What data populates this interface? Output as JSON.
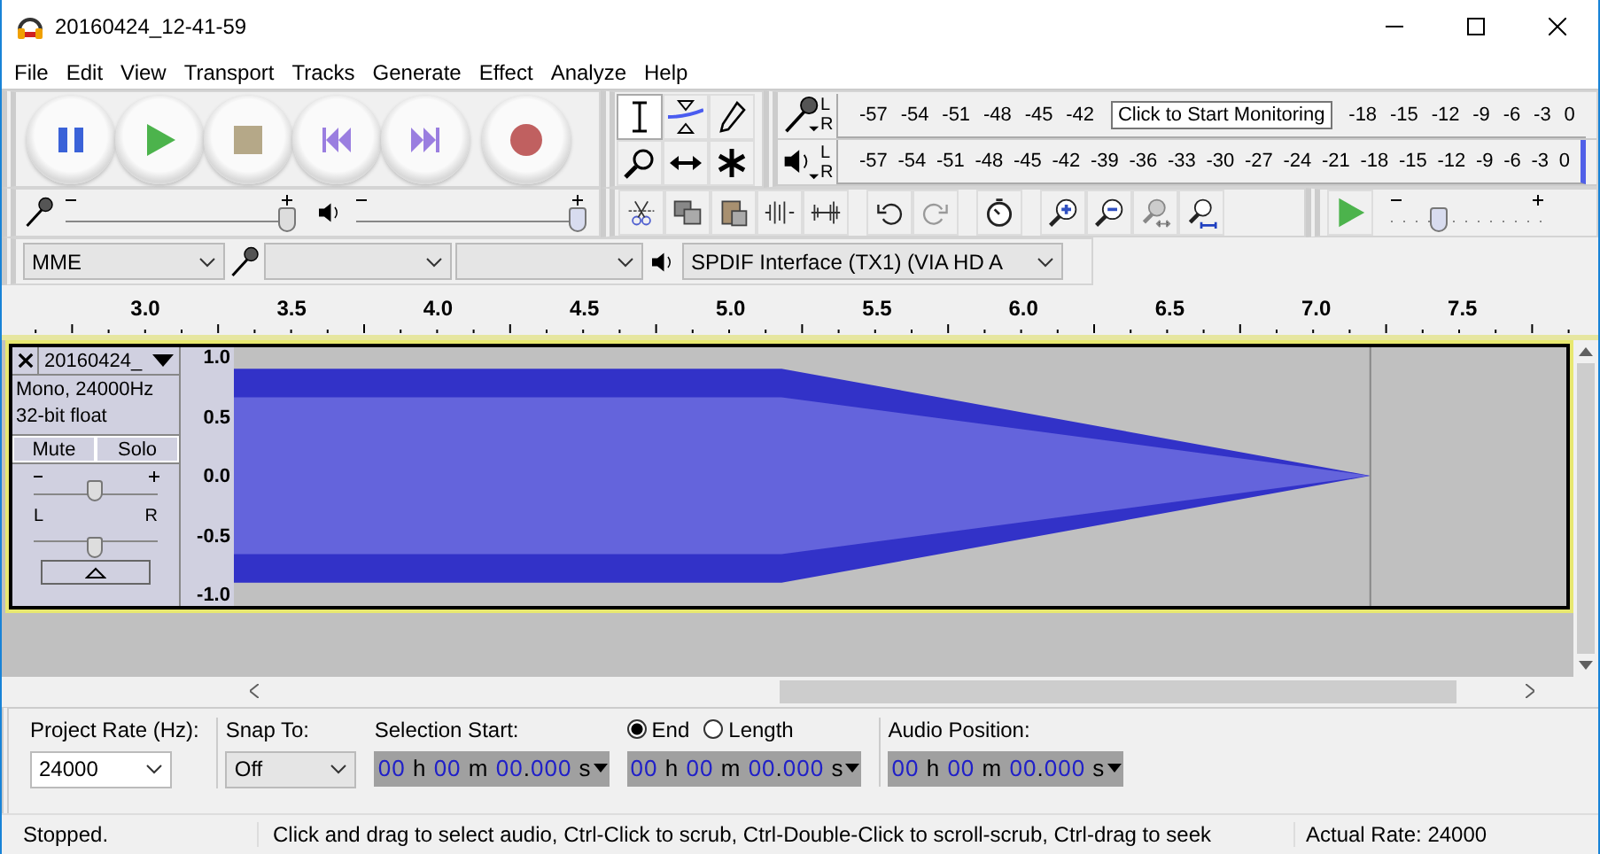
{
  "window": {
    "title": "20160424_12-41-59"
  },
  "menu": [
    "File",
    "Edit",
    "View",
    "Transport",
    "Tracks",
    "Generate",
    "Effect",
    "Analyze",
    "Help"
  ],
  "transport": [
    {
      "kind": "pause"
    },
    {
      "kind": "play"
    },
    {
      "kind": "stop"
    },
    {
      "kind": "start"
    },
    {
      "kind": "end"
    },
    {
      "kind": "record"
    }
  ],
  "tools": [
    {
      "kind": "select",
      "selected": true
    },
    {
      "kind": "envelope",
      "selected": false
    },
    {
      "kind": "draw",
      "selected": false
    },
    {
      "kind": "zoom",
      "selected": false
    },
    {
      "kind": "timeshift",
      "selected": false
    },
    {
      "kind": "multi",
      "selected": false
    }
  ],
  "meters": {
    "recording": {
      "channels": [
        "L",
        "R"
      ],
      "left_ticks": [
        "-57",
        "-54",
        "-51",
        "-48",
        "-45",
        "-42"
      ],
      "tooltip": "Click to Start Monitoring",
      "right_ticks": [
        "-18",
        "-15",
        "-12",
        "-9",
        "-6",
        "-3",
        "0"
      ]
    },
    "playback": {
      "channels": [
        "L",
        "R"
      ],
      "ticks": [
        "-57",
        "-54",
        "-51",
        "-48",
        "-45",
        "-42",
        "-39",
        "-36",
        "-33",
        "-30",
        "-27",
        "-24",
        "-21",
        "-18",
        "-15",
        "-12",
        "-9",
        "-6",
        "-3",
        "0"
      ]
    }
  },
  "mixer": {
    "input": {
      "level": 1.0
    },
    "output": {
      "level": 1.0
    }
  },
  "play_at_speed": {
    "level": 0.35
  },
  "devices": {
    "host": "MME",
    "playback": "SPDIF Interface (TX1) (VIA HD A"
  },
  "ruler": [
    "3.0",
    "3.5",
    "4.0",
    "4.5",
    "5.0",
    "5.5",
    "6.0",
    "6.5",
    "7.0",
    "7.5"
  ],
  "track": {
    "name": "20160424_",
    "info": [
      "Mono, 24000Hz",
      "32-bit float"
    ],
    "mute": "Mute",
    "solo": "Solo",
    "gain": {
      "level": 0.5
    },
    "pan": {
      "left": "L",
      "right": "R",
      "level": 0.5
    },
    "axis": [
      "1.0",
      "0.5",
      "0.0",
      "-0.5",
      "-1.0"
    ]
  },
  "selection": {
    "rate_label": "Project Rate (Hz):",
    "rate": "24000",
    "snap_label": "Snap To:",
    "snap": "Off",
    "start_label": "Selection Start:",
    "start": "00 h 00 m 00.000 s",
    "modes": [
      {
        "label": "End",
        "selected": true
      },
      {
        "label": "Length",
        "selected": false
      }
    ],
    "end": "00 h 00 m 00.000 s",
    "position_label": "Audio Position:",
    "position": "00 h 00 m 00.000 s"
  },
  "status": {
    "state": "Stopped.",
    "hint": "Click and drag to select audio, Ctrl-Click to scrub, Ctrl-Double-Click to scroll-scrub, Ctrl-drag to seek",
    "rate": "Actual Rate: 24000"
  }
}
